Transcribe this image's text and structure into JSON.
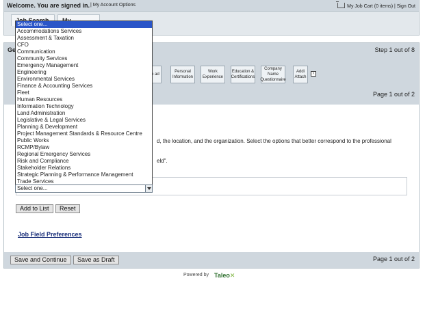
{
  "topbar": {
    "welcome": "Welcome. You are signed in.",
    "account_options": "My Account Options",
    "job_cart": "My Job Cart (0 items)",
    "sign_out": "Sign Out"
  },
  "tabs": [
    "Job Search",
    "My Jobpage"
  ],
  "panel": {
    "title_fragment": "Ge",
    "step": "Step 1 out of 8",
    "page": "Page 1 out of 2",
    "steps": [
      "me\nad",
      "Personal Information",
      "Work Experience",
      "Education & Certifications",
      "Company Name Questionnaire",
      "Addi Attach"
    ],
    "instruction_line1": "d, the location, and the organization. Select the options that better correspond to the professional",
    "instruction_line2": "eld\".",
    "add_to_list": "Add to List",
    "reset": "Reset",
    "preferences_link": "Job Field Preferences",
    "save_continue": "Save and Continue",
    "save_draft": "Save as Draft",
    "footer_page": "Page 1 out of 2"
  },
  "dropdown": {
    "selected_value": "Select one...",
    "options": [
      "Select one...",
      "Accommodations Services",
      "Assessment & Taxation",
      "CFO",
      "Communication",
      "Community Services",
      "Emergency Management",
      "Engineering",
      "Environmental Services",
      "Finance & Accounting Services",
      "Fleet",
      "Human Resources",
      "Information Technology",
      "Land Administration",
      "Legislative & Legal Services",
      "Planning & Development",
      "Project Management Standards & Resource Centre",
      "Public Works",
      "RCMP/Bylaw",
      "Regional Emergency Services",
      "Risk and Compliance",
      "Stakeholder Relations",
      "Strategic Planning & Performance Management",
      "Trade Services"
    ]
  },
  "footer": {
    "powered_by": "Powered by",
    "brand": "Taleo"
  },
  "colors": {
    "bar": "#cfd7de",
    "selection": "#2a55c8",
    "link": "#1a2f7a",
    "brand": "#2d6f2d"
  }
}
